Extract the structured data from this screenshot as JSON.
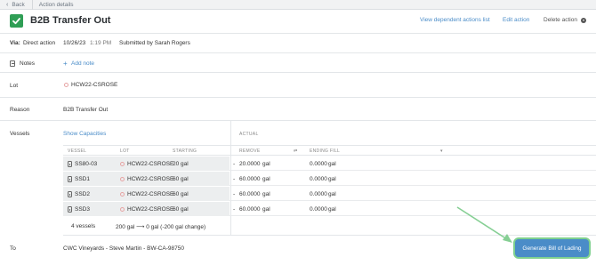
{
  "topbar": {
    "back_label": "Back",
    "breadcrumb": "Action details"
  },
  "header": {
    "title": "B2B Transfer Out",
    "view_dependent": "View dependent actions list",
    "edit": "Edit action",
    "delete": "Delete action"
  },
  "via": {
    "label": "Via:",
    "method": "Direct action",
    "date": "10/26/23",
    "time": "1:19 PM",
    "submitted": "Submitted by Sarah Rogers"
  },
  "notes": {
    "label": "Notes",
    "add": "Add note"
  },
  "lot": {
    "label": "Lot",
    "value": "HCW22-CSROSE"
  },
  "reason": {
    "label": "Reason",
    "value": "B2B Transfer Out"
  },
  "vessels": {
    "label": "Vessels",
    "show_capacities": "Show Capacities",
    "actual": "ACTUAL",
    "headers": {
      "vessel": "VESSEL",
      "lot": "LOT",
      "starting": "STARTING",
      "remove": "REMOVE",
      "ending": "ENDING FILL"
    },
    "rows": [
      {
        "vessel": "SS80-03",
        "lot": "HCW22-CSROSE",
        "starting": "20 gal",
        "remove": "20.0000",
        "remove_unit": "gal",
        "ending": "0.0000",
        "ending_unit": "gal"
      },
      {
        "vessel": "SSD1",
        "lot": "HCW22-CSROSE",
        "starting": "60 gal",
        "remove": "60.0000",
        "remove_unit": "gal",
        "ending": "0.0000",
        "ending_unit": "gal"
      },
      {
        "vessel": "SSD2",
        "lot": "HCW22-CSROSE",
        "starting": "60 gal",
        "remove": "60.0000",
        "remove_unit": "gal",
        "ending": "0.0000",
        "ending_unit": "gal"
      },
      {
        "vessel": "SSD3",
        "lot": "HCW22-CSROSE",
        "starting": "60 gal",
        "remove": "60.0000",
        "remove_unit": "gal",
        "ending": "0.0000",
        "ending_unit": "gal"
      }
    ],
    "summary_count": "4 vessels",
    "summary_change": "200 gal ⟶ 0 gal (-200 gal change)"
  },
  "to": {
    "label": "To",
    "value": "CWC Vineyards - Steve Martin - BW-CA-98750"
  },
  "action_button": "Generate Bill of Lading",
  "colors": {
    "accent": "#4a8cc8",
    "success": "#2f9e55",
    "highlight": "#7fd08f"
  }
}
